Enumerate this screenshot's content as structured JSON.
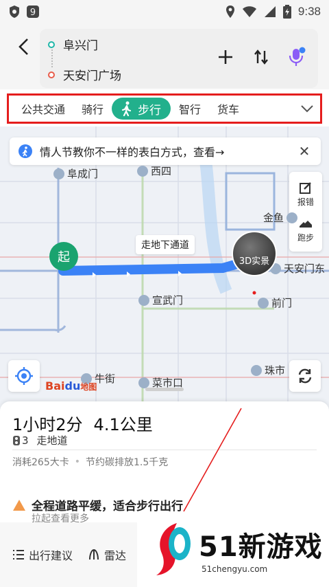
{
  "status_bar": {
    "time": "9:38"
  },
  "route": {
    "start": "阜兴门",
    "end": "天安门广场"
  },
  "tabs": [
    {
      "label": "公共交通",
      "active": false
    },
    {
      "label": "骑行",
      "active": false
    },
    {
      "label": "步行",
      "active": true
    },
    {
      "label": "智行",
      "active": false
    },
    {
      "label": "货车",
      "active": false
    }
  ],
  "map": {
    "promo_text": "情人节教你不一样的表白方式，查看→",
    "side_tools": {
      "report": "报错",
      "run": "跑步"
    },
    "labels": {
      "fuchengmen": "阜成门",
      "xisi": "西四",
      "jinyu": "金鱼",
      "tiananmen_east": "天安门东",
      "xuanwumen": "宣武门",
      "qianmen": "前门",
      "niujie": "牛街",
      "caishikou": "菜市口",
      "zhushi": "珠市"
    },
    "start_marker": "起",
    "underpass": "走地下通道",
    "view3d": "3D实景",
    "logo_bai": "Bai",
    "logo_du": "du",
    "logo_ditu": "地图"
  },
  "summary": {
    "duration": "1小时2分",
    "distance": "4.1公里",
    "lights": "3",
    "road_type": "走地道",
    "calories": "消耗265大卡",
    "carbon": "节约碳排放1.5千克",
    "notice": "全程道路平缓，适合步行出行",
    "notice_sub": "拉起查看更多"
  },
  "bottom_bar": {
    "advice": "出行建议",
    "radar": "雷达"
  },
  "watermark": {
    "brand": "51新游戏",
    "url": "51chengyu.com"
  },
  "colors": {
    "accent_green": "#22b08c",
    "route_blue": "#3b82f6",
    "highlight_red": "#e51d1d"
  }
}
